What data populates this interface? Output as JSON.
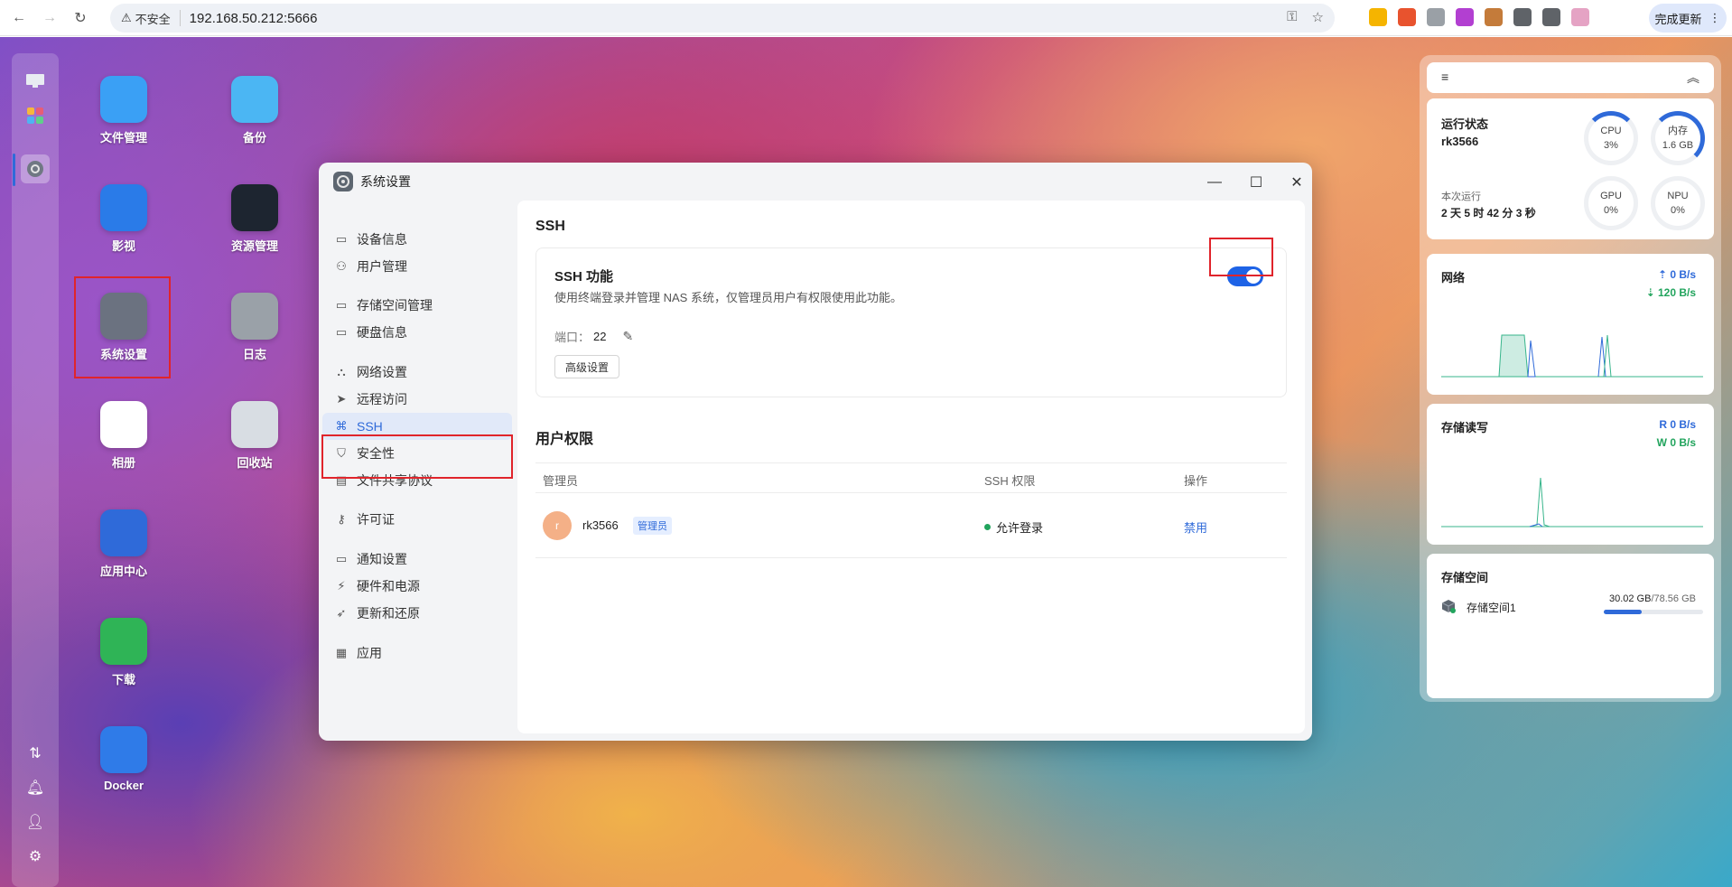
{
  "browser": {
    "security_label": "不安全",
    "url": "192.168.50.212:5666",
    "update_label": "完成更新",
    "extension_colors": [
      "#f5b400",
      "#e8532e",
      "#9aa0a6",
      "#b23fd1",
      "#c47b3a",
      "#5f6368",
      "#5f6368",
      "#e5a3c4"
    ]
  },
  "desktop": {
    "apps": [
      {
        "label": "文件管理",
        "icon": "folder-icon",
        "color": "#3aa0f5"
      },
      {
        "label": "备份",
        "icon": "backup-icon",
        "color": "#4bb6f3"
      },
      {
        "label": "影视",
        "icon": "video-icon",
        "color": "#2a7be8"
      },
      {
        "label": "资源管理",
        "icon": "monitor-icon",
        "color": "#1d2530"
      },
      {
        "label": "系统设置",
        "icon": "settings-icon",
        "color": "#6b7280"
      },
      {
        "label": "日志",
        "icon": "log-icon",
        "color": "#9aa1a8"
      },
      {
        "label": "相册",
        "icon": "photos-icon",
        "color": "#ffffff"
      },
      {
        "label": "回收站",
        "icon": "trash-icon",
        "color": "#d8dde3"
      },
      {
        "label": "应用中心",
        "icon": "store-icon",
        "color": "#2f6ad9"
      },
      {
        "label": "下载",
        "icon": "download-icon",
        "color": "#2fb456"
      },
      {
        "label": "Docker",
        "icon": "docker-icon",
        "color": "#2f7be8"
      }
    ]
  },
  "window": {
    "title": "系统设置",
    "nav": [
      {
        "label": "设备信息",
        "icon": "device-icon"
      },
      {
        "label": "用户管理",
        "icon": "users-icon"
      },
      {
        "label": "存储空间管理",
        "icon": "storage-icon"
      },
      {
        "label": "硬盘信息",
        "icon": "disk-icon"
      },
      {
        "label": "网络设置",
        "icon": "network-icon"
      },
      {
        "label": "远程访问",
        "icon": "remote-icon"
      },
      {
        "label": "SSH",
        "icon": "ssh-icon"
      },
      {
        "label": "安全性",
        "icon": "shield-icon"
      },
      {
        "label": "文件共享协议",
        "icon": "file-share-icon"
      },
      {
        "label": "许可证",
        "icon": "key-icon"
      },
      {
        "label": "通知设置",
        "icon": "notification-icon"
      },
      {
        "label": "硬件和电源",
        "icon": "power-icon"
      },
      {
        "label": "更新和还原",
        "icon": "rocket-icon"
      },
      {
        "label": "应用",
        "icon": "apps-icon"
      }
    ],
    "content": {
      "heading": "SSH",
      "ssh_title": "SSH 功能",
      "ssh_desc": "使用终端登录并管理 NAS 系统，仅管理员用户有权限使用此功能。",
      "port_label": "端口：",
      "port_value": "22",
      "advanced_label": "高级设置",
      "ssh_enabled": true,
      "perm_heading": "用户权限",
      "table": {
        "columns": [
          "管理员",
          "SSH 权限",
          "操作"
        ],
        "rows": [
          {
            "avatar": "r",
            "name": "rk3566",
            "badge": "管理员",
            "status": "允许登录",
            "action": "禁用"
          }
        ]
      }
    }
  },
  "widgets": {
    "status": {
      "title": "运行状态",
      "device": "rk3566",
      "uptime_label": "本次运行",
      "uptime": "2 天 5 时 42 分 3 秒",
      "gauges": [
        {
          "name": "CPU",
          "value": "3%"
        },
        {
          "name": "内存",
          "value": "1.6 GB"
        },
        {
          "name": "GPU",
          "value": "0%"
        },
        {
          "name": "NPU",
          "value": "0%"
        }
      ]
    },
    "network": {
      "title": "网络",
      "up": "0 B/s",
      "down": "120 B/s"
    },
    "storage_io": {
      "title": "存储读写",
      "read": "R 0 B/s",
      "write": "W 0 B/s"
    },
    "storage": {
      "title": "存储空间",
      "pool": "存储空间1",
      "used": "30.02 GB",
      "total": "/78.56 GB",
      "used_fraction": 0.38
    }
  }
}
